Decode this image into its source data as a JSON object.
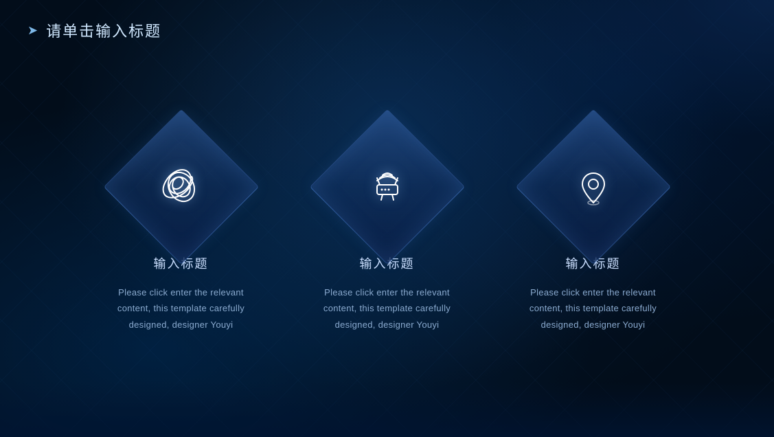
{
  "header": {
    "arrow": "➤",
    "title": "请单击输入标题"
  },
  "cards": [
    {
      "id": "card-1",
      "icon": "paperclip",
      "title": "输入标题",
      "description": "Please click enter the relevant content, this template carefully designed, designer Youyi"
    },
    {
      "id": "card-2",
      "icon": "router",
      "title": "输入标题",
      "description": "Please click enter the relevant content, this template carefully designed, designer Youyi"
    },
    {
      "id": "card-3",
      "icon": "location",
      "title": "输入标题",
      "description": "Please click enter the relevant content, this template carefully designed, designer Youyi"
    }
  ]
}
